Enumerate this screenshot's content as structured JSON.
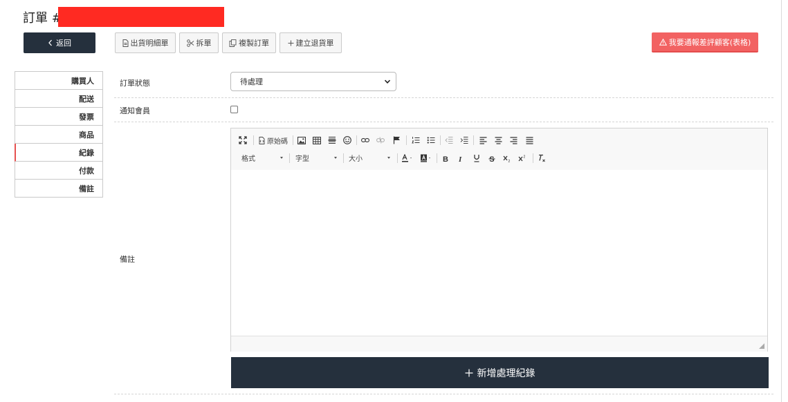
{
  "header": {
    "title": "訂單 #"
  },
  "toolbar": {
    "back": "返回",
    "shipping_detail": "出貨明細單",
    "split": "拆單",
    "copy_order": "複製訂單",
    "create_return": "建立退貨單",
    "report_customer": "我要通報差評顧客(表格)"
  },
  "sidebar": {
    "items": [
      {
        "label": "購買人"
      },
      {
        "label": "配送"
      },
      {
        "label": "發票"
      },
      {
        "label": "商品"
      },
      {
        "label": "紀錄"
      },
      {
        "label": "付款"
      },
      {
        "label": "備註"
      }
    ],
    "active_index": 4
  },
  "form": {
    "status_label": "訂單狀態",
    "status_value": "待處理",
    "notify_label": "通知會員",
    "notify_checked": false,
    "notes_label": "備註"
  },
  "editor": {
    "source_label": "原始碼",
    "format_label": "格式",
    "font_label": "字型",
    "size_label": "大小",
    "icons": [
      "maximize-icon",
      "source-icon",
      "image-icon",
      "table-icon",
      "horizontal-rule-icon",
      "emoji-icon",
      "link-icon",
      "unlink-icon",
      "anchor-flag-icon",
      "numbered-list-icon",
      "bulleted-list-icon",
      "outdent-icon",
      "indent-icon",
      "align-left-icon",
      "align-center-icon",
      "align-right-icon",
      "justify-icon",
      "text-color-icon",
      "background-color-icon",
      "bold-icon",
      "italic-icon",
      "underline-icon",
      "strikethrough-icon",
      "subscript-icon",
      "superscript-icon",
      "remove-format-icon"
    ],
    "content": ""
  },
  "add_record": {
    "label": "新增處理紀錄"
  },
  "colors": {
    "dark": "#25303d",
    "alert": "#f26262",
    "active_marker": "#e6504f"
  }
}
